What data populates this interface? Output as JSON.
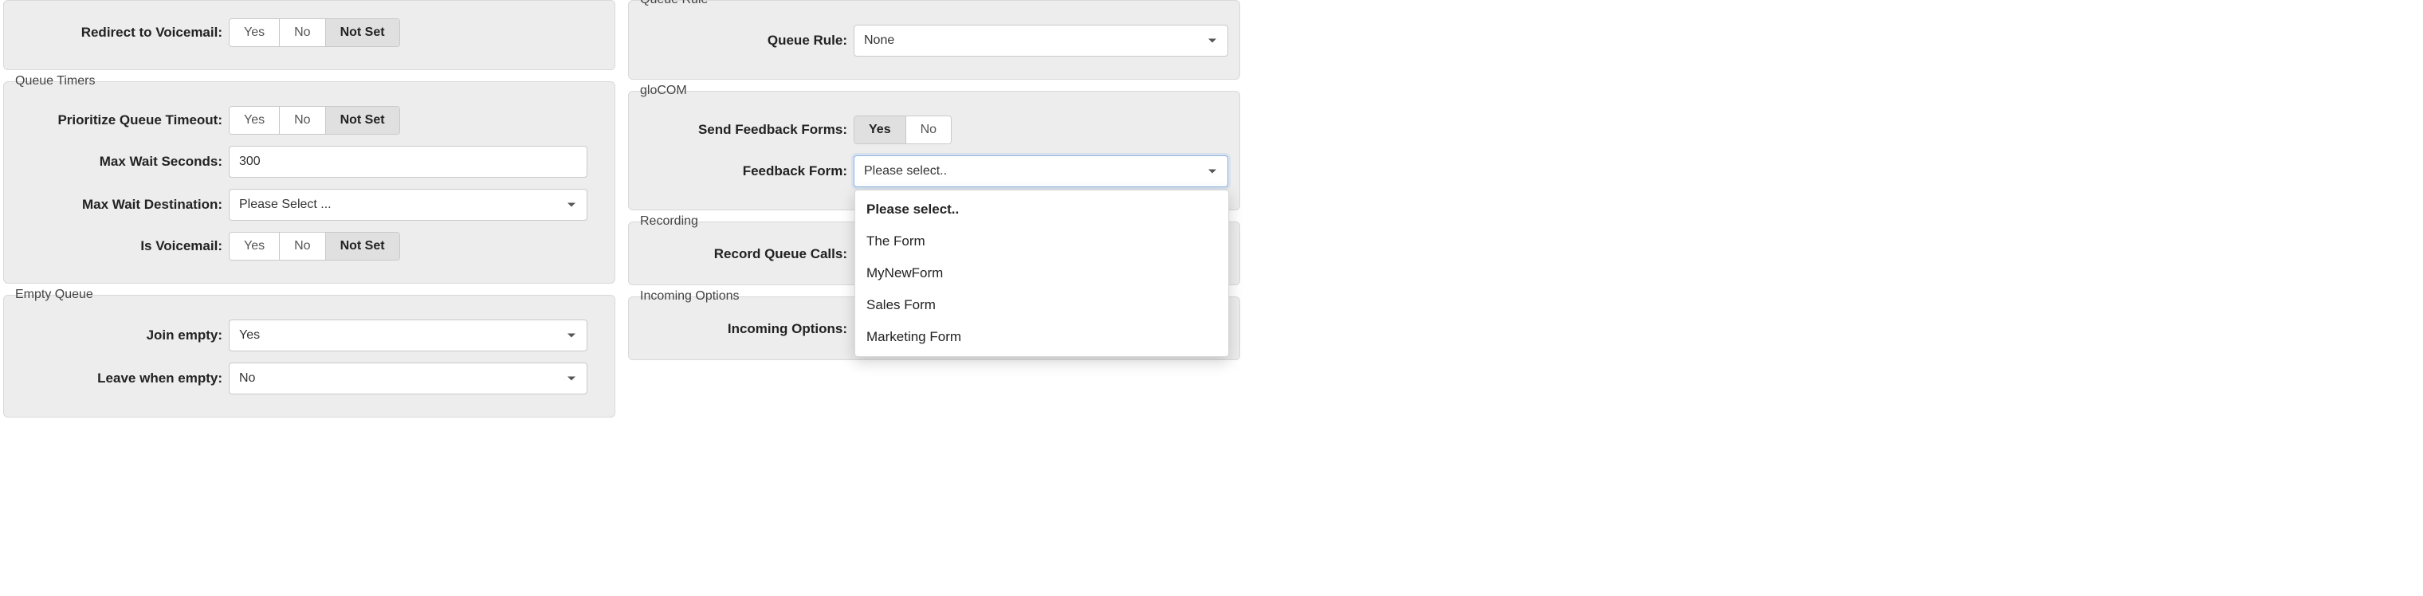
{
  "left": {
    "redirect_voicemail": {
      "label": "Redirect to Voicemail:",
      "yes": "Yes",
      "no": "No",
      "notset": "Not Set"
    },
    "queue_timers": {
      "title": "Queue Timers",
      "prioritize": {
        "label": "Prioritize Queue Timeout:",
        "yes": "Yes",
        "no": "No",
        "notset": "Not Set"
      },
      "max_wait_seconds": {
        "label": "Max Wait Seconds:",
        "value": "300"
      },
      "max_wait_destination": {
        "label": "Max Wait Destination:",
        "value": "Please Select ..."
      },
      "is_voicemail": {
        "label": "Is Voicemail:",
        "yes": "Yes",
        "no": "No",
        "notset": "Not Set"
      }
    },
    "empty_queue": {
      "title": "Empty Queue",
      "join_empty": {
        "label": "Join empty:",
        "value": "Yes"
      },
      "leave_when_empty": {
        "label": "Leave when empty:",
        "value": "No"
      }
    }
  },
  "right": {
    "queue_rule": {
      "title": "Queue Rule",
      "label": "Queue Rule:",
      "value": "None"
    },
    "glocom": {
      "title": "gloCOM",
      "send_ff": {
        "label": "Send Feedback Forms:",
        "yes": "Yes",
        "no": "No"
      },
      "feedback_form": {
        "label": "Feedback Form:",
        "value": "Please select..",
        "options": [
          "Please select..",
          "The Form",
          "MyNewForm",
          "Sales Form",
          "Marketing Form"
        ]
      }
    },
    "recording": {
      "title": "Recording",
      "record_label": "Record Queue Calls:"
    },
    "incoming": {
      "title": "Incoming Options",
      "label": "Incoming Options:"
    }
  }
}
